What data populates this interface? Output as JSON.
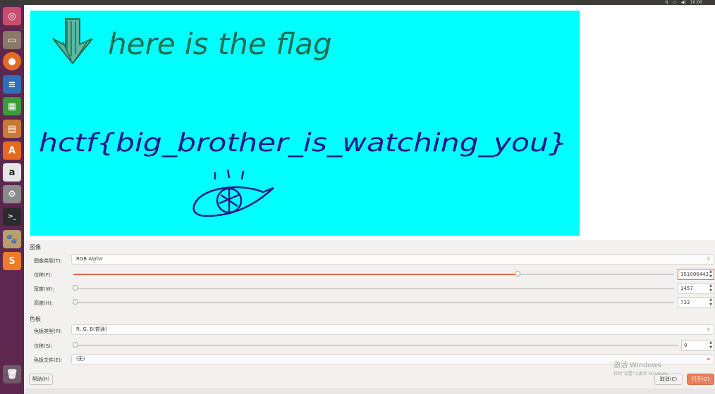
{
  "topbar": {
    "time": "10:00"
  },
  "launcher": {
    "items": [
      "ubuntu-dash",
      "files",
      "firefox",
      "libreoffice-writer",
      "libreoffice-calc",
      "libreoffice-impress",
      "ubuntu-software",
      "amazon",
      "system-settings",
      "terminal",
      "gimp",
      "sublime-text",
      "trash"
    ]
  },
  "preview": {
    "line1": "here is the flag",
    "line2": "hctf{big_brother_is_watching_you}",
    "colors": {
      "background": "#00ffff",
      "pen_green": "#1d6f52",
      "pen_blue": "#1e1a8a"
    }
  },
  "image_section": {
    "title": "图像",
    "type_label": "图像类型(T):",
    "type_value": "RGB Alpha",
    "offset_label": "位移(F):",
    "offset_value": "151086443",
    "offset_level": 0.74,
    "width_label": "宽度(W):",
    "width_value": "1457",
    "height_label": "高度(H):",
    "height_value": "733"
  },
  "palette_section": {
    "title": "色板",
    "type_label": "色板类型(P):",
    "type_value": "R, G, B(普通)",
    "offset_label": "位移(S):",
    "offset_value": "0",
    "file_label": "色板文件(E):",
    "file_value": "(无)"
  },
  "buttons": {
    "help": "帮助(H)",
    "cancel": "取消(C)",
    "open": "打开(O)"
  },
  "watermark": {
    "line1": "激活 Windows",
    "line2": "转到\"设置\"以激活 Windows。"
  },
  "accent": "#e0683c"
}
